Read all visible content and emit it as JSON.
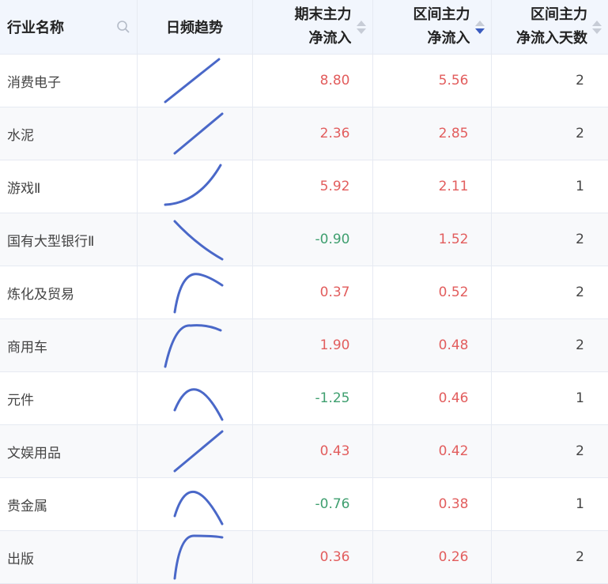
{
  "headers": {
    "name": "行业名称",
    "trend": "日频趋势",
    "end_flow_line1": "期末主力",
    "end_flow_line2": "净流入",
    "range_flow_line1": "区间主力",
    "range_flow_line2": "净流入",
    "days_line1": "区间主力",
    "days_line2": "净流入天数"
  },
  "icons": {
    "search": "search-icon",
    "sort": "sort-icon"
  },
  "colors": {
    "positive": "#e25d5d",
    "negative": "#3f9f6f",
    "sparkline": "#4a68c8",
    "header_bg": "#f2f6fd"
  },
  "rows": [
    {
      "name": "消费电子",
      "end_flow": "8.80",
      "range_flow": "5.56",
      "days": "2"
    },
    {
      "name": "水泥",
      "end_flow": "2.36",
      "range_flow": "2.85",
      "days": "2"
    },
    {
      "name": "游戏Ⅱ",
      "end_flow": "5.92",
      "range_flow": "2.11",
      "days": "1"
    },
    {
      "name": "国有大型银行Ⅱ",
      "end_flow": "-0.90",
      "range_flow": "1.52",
      "days": "2"
    },
    {
      "name": "炼化及贸易",
      "end_flow": "0.37",
      "range_flow": "0.52",
      "days": "2"
    },
    {
      "name": "商用车",
      "end_flow": "1.90",
      "range_flow": "0.48",
      "days": "2"
    },
    {
      "name": "元件",
      "end_flow": "-1.25",
      "range_flow": "0.46",
      "days": "1"
    },
    {
      "name": "文娱用品",
      "end_flow": "0.43",
      "range_flow": "0.42",
      "days": "2"
    },
    {
      "name": "贵金属",
      "end_flow": "-0.76",
      "range_flow": "0.38",
      "days": "1"
    },
    {
      "name": "出版",
      "end_flow": "0.36",
      "range_flow": "0.26",
      "days": "2"
    }
  ]
}
